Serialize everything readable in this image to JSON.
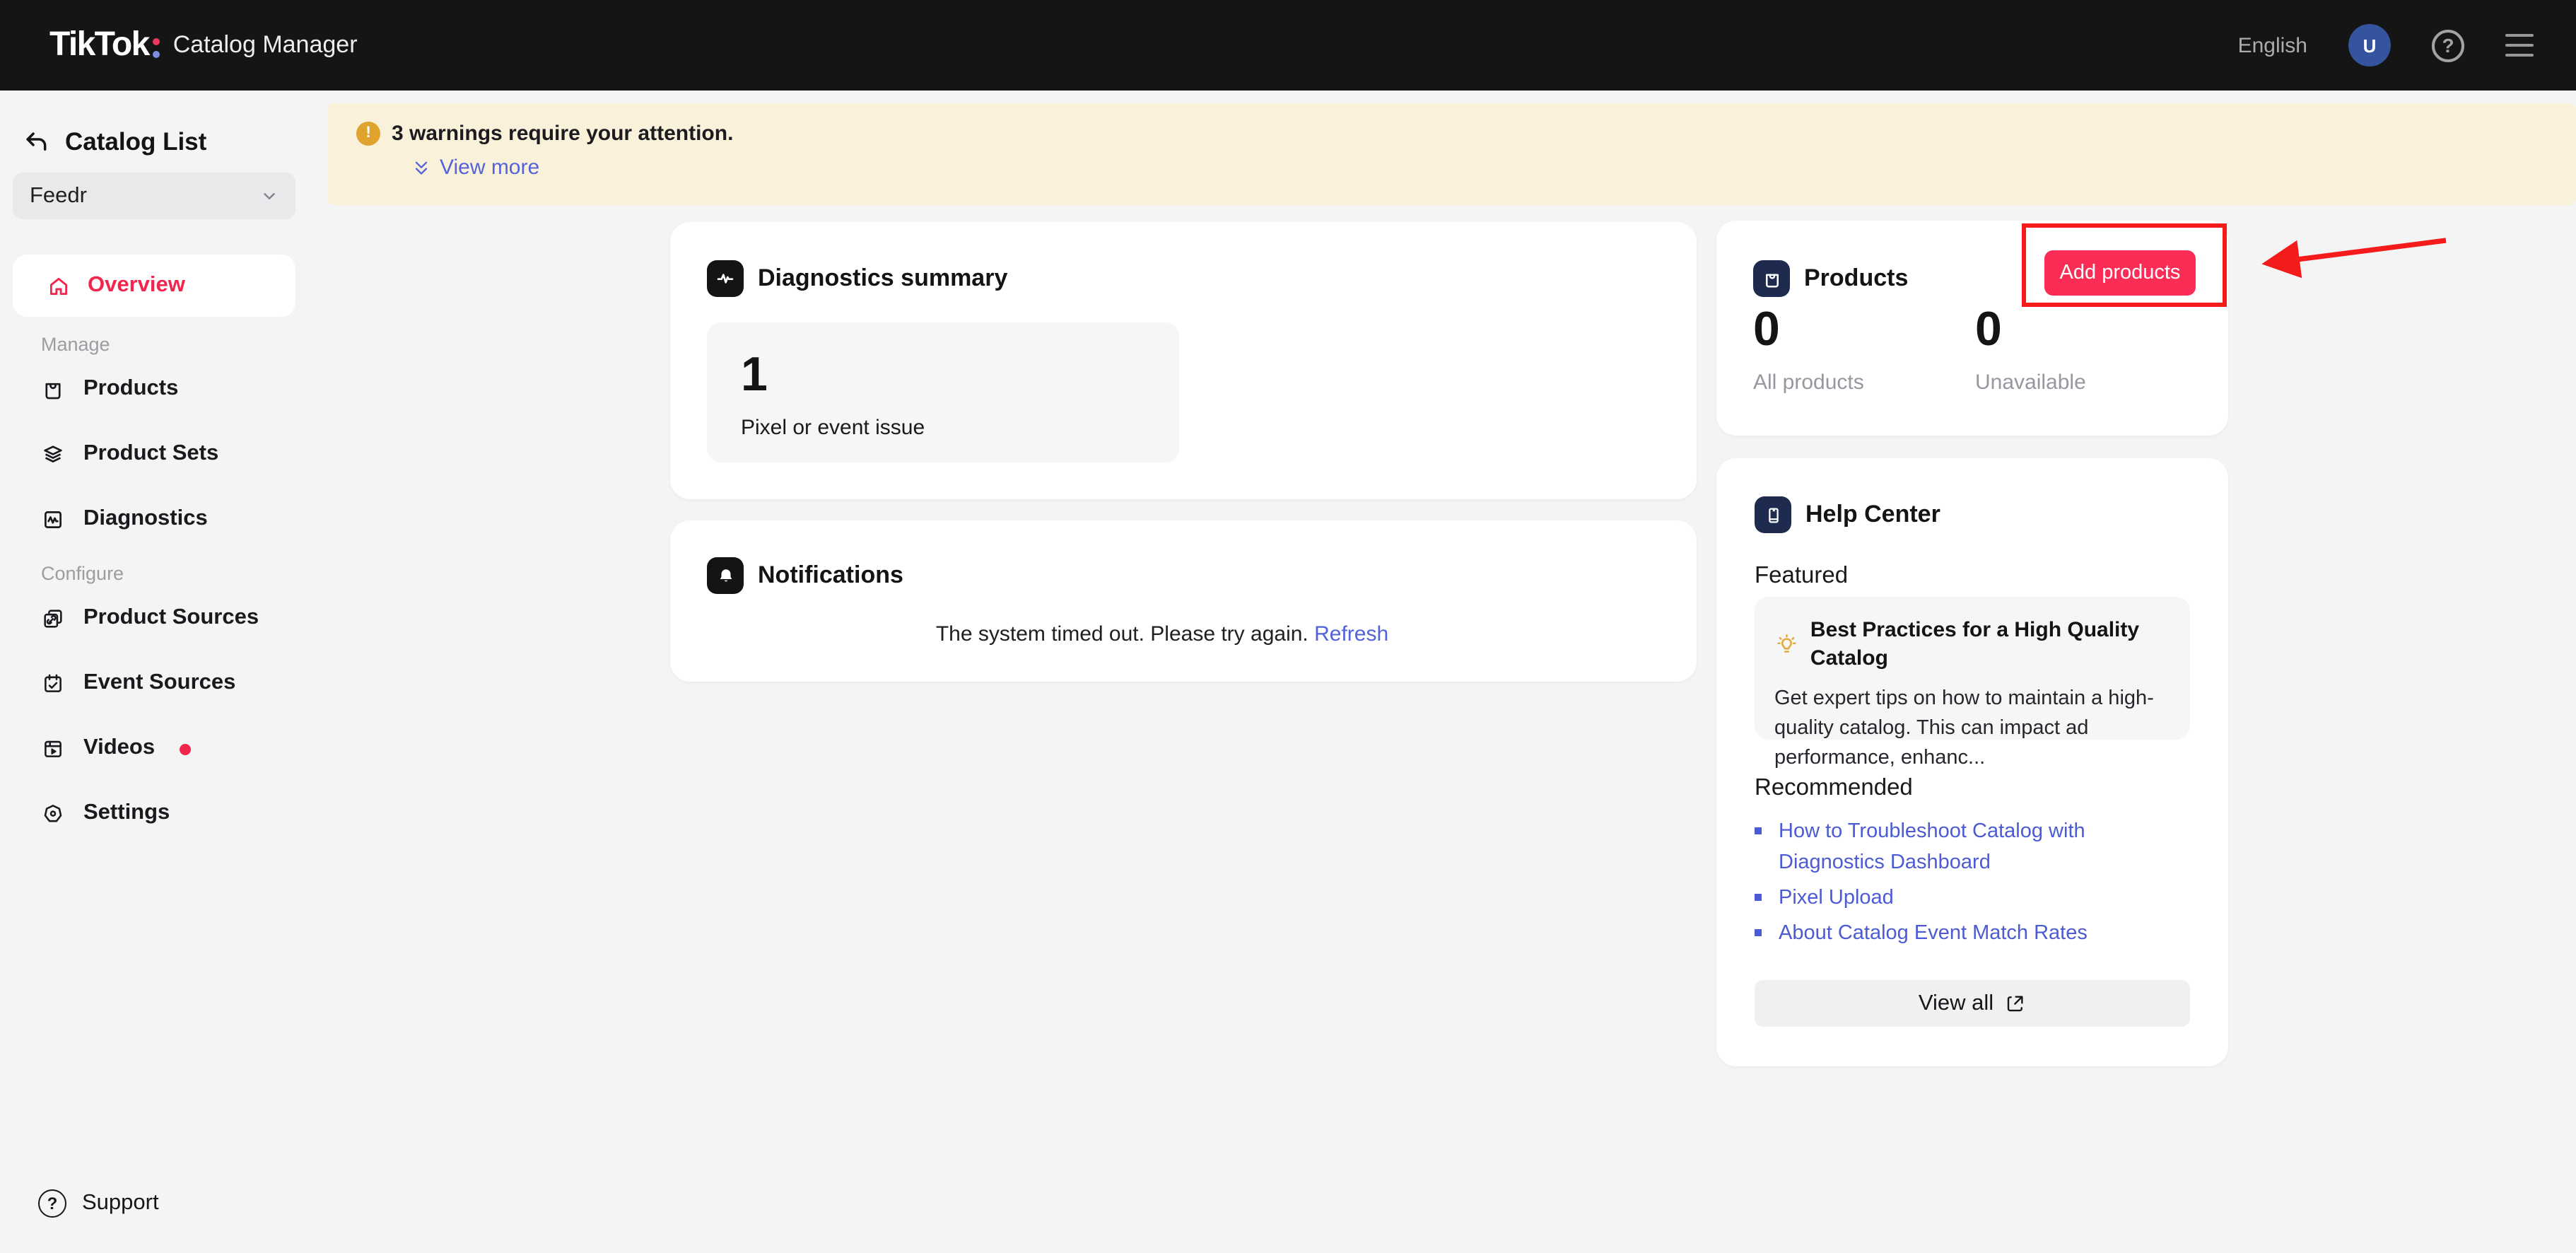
{
  "colors": {
    "accent_red": "#FB2C55",
    "overview_red": "#F1264F",
    "link_blue": "#5262D9",
    "warning_bg": "#FAF1DA",
    "warning_icon": "#DFA32E",
    "navy_icon_tile": "#1E2B4E",
    "black_icon_tile": "#141414",
    "header_bg": "#151515",
    "avatar_blue": "#35549E",
    "annotation_red": "#F61B1B"
  },
  "header": {
    "logo_text": "TikTok",
    "app_name": "Catalog Manager",
    "language": "English",
    "avatar_initial": "U"
  },
  "sidebar": {
    "title": "Catalog List",
    "catalog_selector_value": "Feedr",
    "overview_label": "Overview",
    "sections": [
      {
        "label": "Manage",
        "items": [
          "Products",
          "Product Sets",
          "Diagnostics"
        ]
      },
      {
        "label": "Configure",
        "items": [
          "Product Sources",
          "Event Sources",
          "Videos",
          "Settings"
        ]
      }
    ],
    "support_label": "Support"
  },
  "banner": {
    "warning_text": "3 warnings require your attention.",
    "view_more_label": "View more"
  },
  "main": {
    "diagnostics_summary": {
      "title": "Diagnostics summary",
      "issue_count": "1",
      "issue_label": "Pixel or event issue"
    },
    "notifications": {
      "title": "Notifications",
      "message": "The system timed out. Please try again.",
      "refresh_label": "Refresh"
    },
    "products": {
      "title": "Products",
      "add_button_label": "Add products",
      "stats": [
        {
          "value": "0",
          "label": "All products"
        },
        {
          "value": "0",
          "label": "Unavailable"
        }
      ]
    },
    "help_center": {
      "title": "Help Center",
      "featured_heading": "Featured",
      "featured": {
        "title": "Best Practices for a High Quality Catalog",
        "description": "Get expert tips on how to maintain a high-quality catalog. This can impact ad performance, enhanc..."
      },
      "recommended_heading": "Recommended",
      "links": [
        "How to Troubleshoot Catalog with Diagnostics Dashboard",
        "Pixel Upload",
        "About Catalog Event Match Rates"
      ],
      "view_all_label": "View all"
    }
  },
  "icons": {
    "back-icon": "undo-arrow",
    "chevron-down-icon": "v",
    "home-icon": "house",
    "products-icon": "shopping-bag",
    "product-sets-icon": "layers",
    "diagnostics-icon": "pulse-square",
    "product-sources-icon": "linked-pages",
    "event-sources-icon": "calendar-check",
    "videos-icon": "video-frame",
    "settings-icon": "heptagon-dot",
    "warning-icon": "!",
    "double-chevron-down-icon": "»",
    "pulse-icon": "heartbeat",
    "bell-icon": "bell",
    "bag-icon": "shopping-bag",
    "book-icon": "guide-book",
    "bulb-icon": "lightbulb",
    "external-link-icon": "open-in-new",
    "help-icon": "?",
    "menu-icon": "hamburger"
  }
}
